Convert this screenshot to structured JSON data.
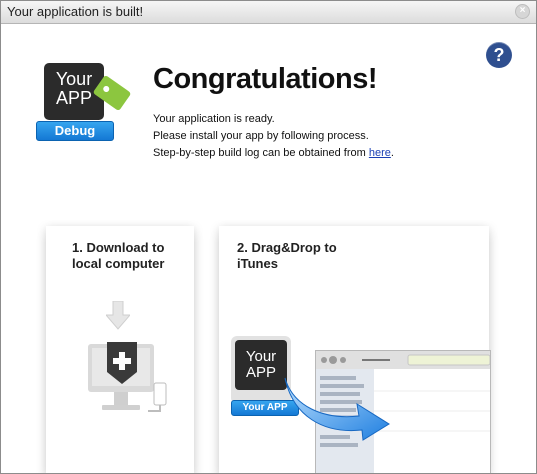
{
  "window": {
    "title": "Your application is built!",
    "close_glyph": "×"
  },
  "help": {
    "icon": "question-mark-icon",
    "glyph": "?"
  },
  "app_badge": {
    "line1": "Your",
    "line2": "APP",
    "debug_label": "Debug",
    "tag_color": "#8cc63f"
  },
  "message": {
    "heading": "Congratulations!",
    "line1": "Your application is ready.",
    "line2": "Please install your app by following process.",
    "line3_prefix": "Step-by-step build log can be obtained from ",
    "line3_link": "here",
    "line3_suffix": "."
  },
  "steps": [
    {
      "title": "1. Download to local computer",
      "icon": "download-to-computer-icon"
    },
    {
      "title": "2. Drag&Drop to iTunes",
      "icon": "drag-to-itunes-icon",
      "tile_line1": "Your",
      "tile_line2": "APP",
      "tile_label": "Your APP"
    }
  ],
  "colors": {
    "accent_blue": "#1478d4",
    "help_blue": "#2f4f8f",
    "link": "#1a3fb4"
  }
}
